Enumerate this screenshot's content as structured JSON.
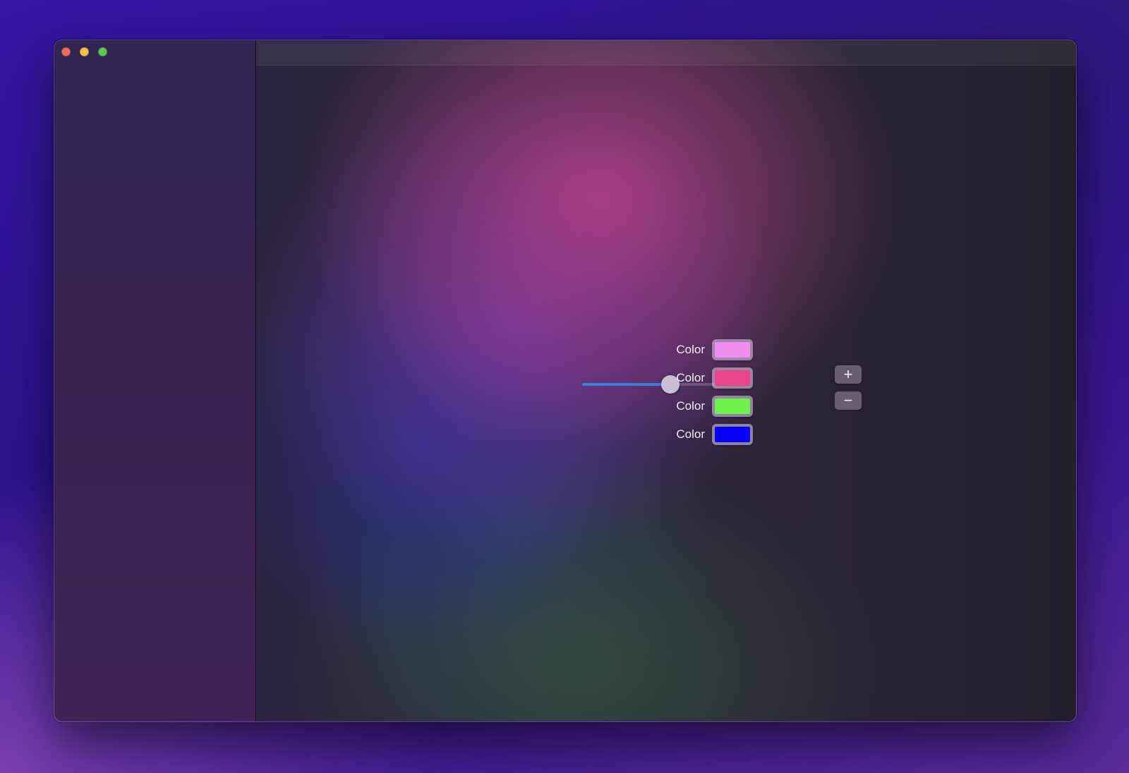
{
  "window": {
    "traffic_lights": [
      "close",
      "minimize",
      "zoom"
    ]
  },
  "slider": {
    "value": 0.64
  },
  "color_rows": [
    {
      "label": "Color",
      "color": "#f08cf2"
    },
    {
      "label": "Color",
      "color": "#e8458a"
    },
    {
      "label": "Color",
      "color": "#6ef24a"
    },
    {
      "label": "Color",
      "color": "#0a00f5"
    }
  ],
  "buttons": {
    "add_label": "+",
    "remove_label": "−"
  },
  "colors": {
    "slider_accent": "#3d7be0",
    "close": "#ec6a5e",
    "minimize": "#f4bf4f",
    "zoom": "#61c554"
  }
}
